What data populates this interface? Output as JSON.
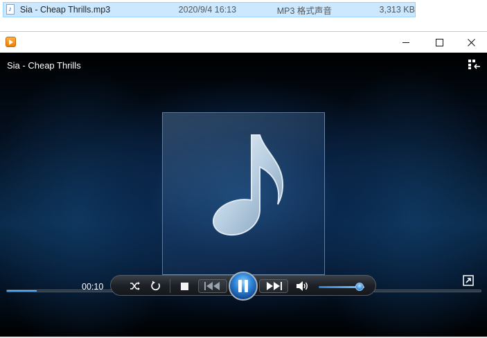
{
  "explorer": {
    "file_name": "Sia - Cheap Thrills.mp3",
    "date_modified": "2020/9/4 16:13",
    "file_type": "MP3 格式声音",
    "file_size": "3,313 KB"
  },
  "player": {
    "window_controls": {
      "minimize": "minimize-icon",
      "maximize": "maximize-icon",
      "close": "close-icon"
    },
    "track_title": "Sia - Cheap Thrills",
    "elapsed_time": "00:10",
    "progress_fraction": 0.063,
    "volume_fraction": 0.9,
    "icons": {
      "app": "media-player-icon",
      "switch_to_library": "switch-to-library-icon",
      "album_art": "music-note-icon",
      "shuffle": "shuffle-icon",
      "repeat": "repeat-icon",
      "stop": "stop-icon",
      "previous": "previous-icon",
      "play_pause": "pause-icon",
      "next": "next-icon",
      "volume": "speaker-icon",
      "fullscreen": "fullscreen-icon"
    },
    "colors": {
      "accent_blue": "#2f85d8",
      "selection": "#cce8ff"
    }
  }
}
